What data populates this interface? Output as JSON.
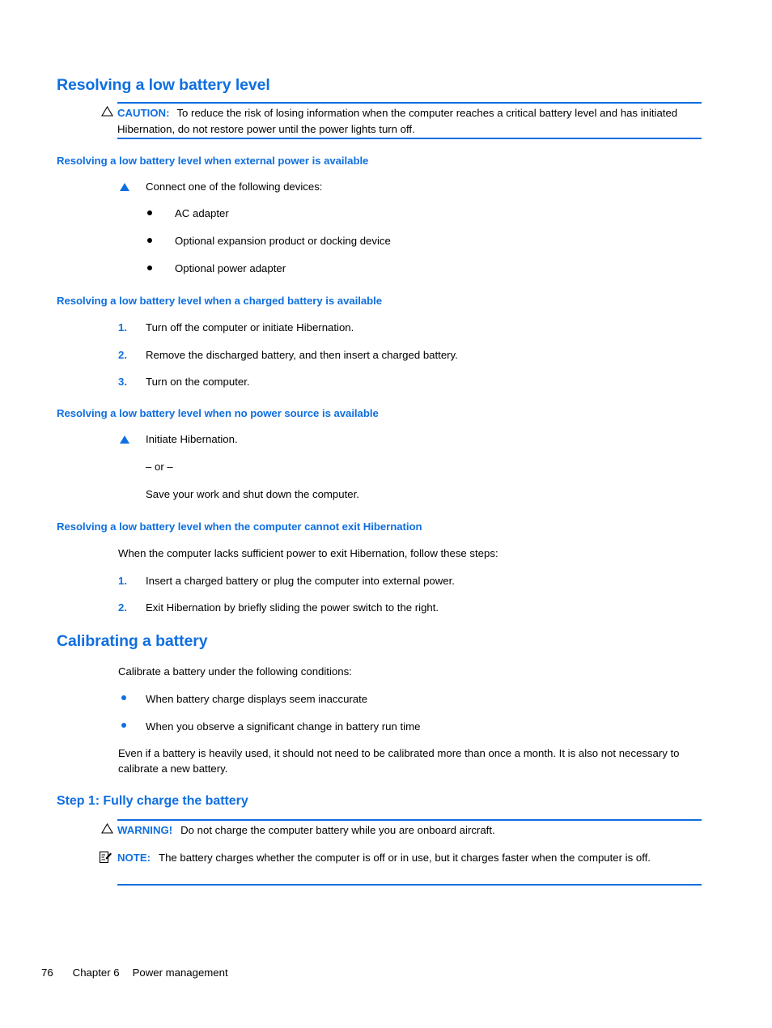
{
  "page": {
    "footer_page_number": "76",
    "footer_chapter": "Chapter 6",
    "footer_title": "Power management",
    "accent_color": "#0f6fe0",
    "text_color": "#000000",
    "background_color": "#ffffff"
  },
  "sections": {
    "resolving": {
      "heading": "Resolving a low battery level",
      "caution": {
        "label": "CAUTION:",
        "icon": "warning-triangle-icon",
        "text": "To reduce the risk of losing information when the computer reaches a critical battery level and has initiated Hibernation, do not restore power until the power lights turn off."
      },
      "sub1": {
        "heading": "Resolving a low battery level when external power is available",
        "step": "Connect one of the following devices:",
        "bullets": [
          "AC adapter",
          "Optional expansion product or docking device",
          "Optional power adapter"
        ]
      },
      "sub2": {
        "heading": "Resolving a low battery level when a charged battery is available",
        "steps": [
          {
            "number": "1.",
            "text": "Turn off the computer or initiate Hibernation."
          },
          {
            "number": "2.",
            "text": "Remove the discharged battery, and then insert a charged battery."
          },
          {
            "number": "3.",
            "text": "Turn on the computer."
          }
        ]
      },
      "sub3": {
        "heading": "Resolving a low battery level when no power source is available",
        "step": "Initiate Hibernation.",
        "or_separator": "– or –",
        "alternative": "Save your work and shut down the computer."
      },
      "sub4": {
        "heading": "Resolving a low battery level when the computer cannot exit Hibernation",
        "intro": "When the computer lacks sufficient power to exit Hibernation, follow these steps:",
        "steps": [
          {
            "number": "1.",
            "text": "Insert a charged battery or plug the computer into external power."
          },
          {
            "number": "2.",
            "text": "Exit Hibernation by briefly sliding the power switch to the right."
          }
        ]
      }
    },
    "calibrating": {
      "heading": "Calibrating a battery",
      "intro": "Calibrate a battery under the following conditions:",
      "bullets": [
        "When battery charge displays seem inaccurate",
        "When you observe a significant change in battery run time"
      ],
      "note_paragraph": "Even if a battery is heavily used, it should not need to be calibrated more than once a month. It is also not necessary to calibrate a new battery.",
      "step1": {
        "heading": "Step 1: Fully charge the battery",
        "warning": {
          "label": "WARNING!",
          "icon": "warning-triangle-icon",
          "text": "Do not charge the computer battery while you are onboard aircraft."
        },
        "note": {
          "label": "NOTE:",
          "icon": "note-clipboard-icon",
          "text": "The battery charges whether the computer is off or in use, but it charges faster when the computer is off."
        }
      }
    }
  }
}
